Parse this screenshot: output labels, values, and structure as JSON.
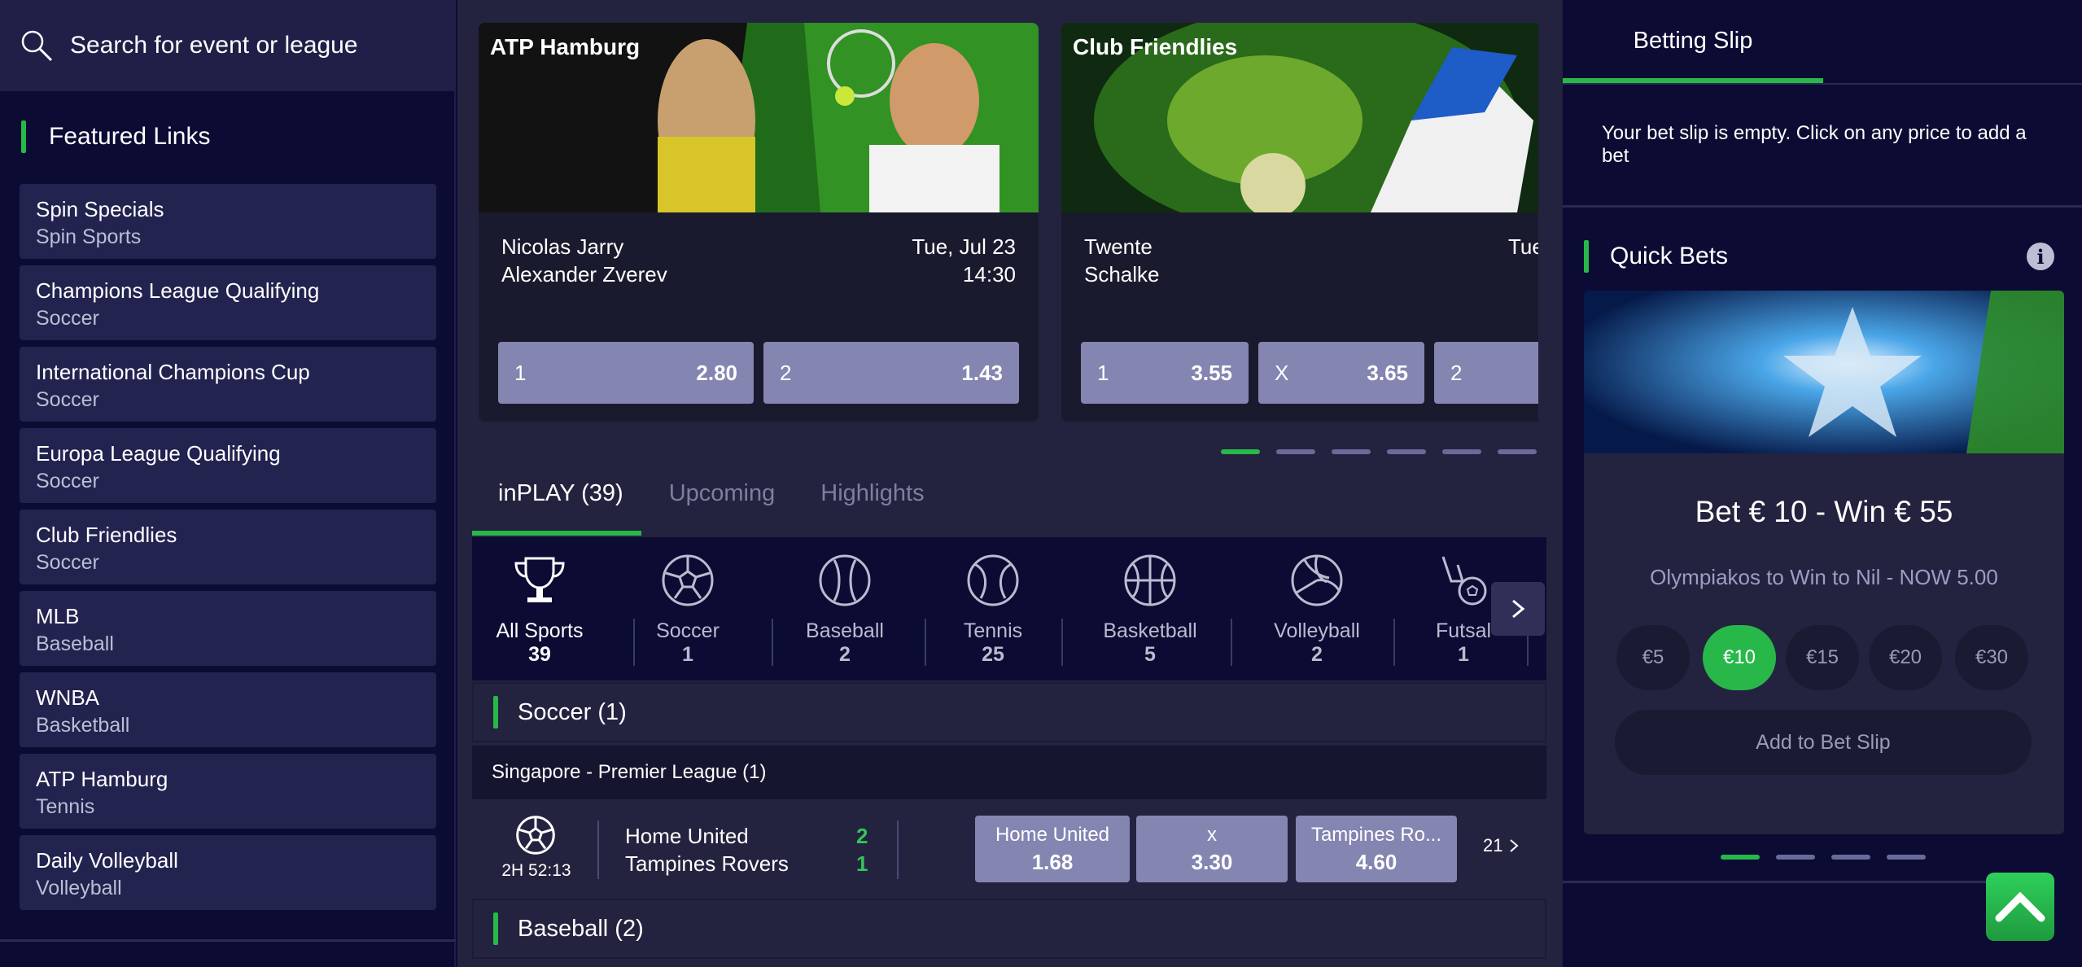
{
  "search": {
    "placeholder": "Search for event or league"
  },
  "featured": {
    "title": "Featured Links",
    "items": [
      {
        "name": "Spin Specials",
        "sport": "Spin Sports"
      },
      {
        "name": "Champions League Qualifying",
        "sport": "Soccer"
      },
      {
        "name": "International Champions Cup",
        "sport": "Soccer"
      },
      {
        "name": "Europa League Qualifying",
        "sport": "Soccer"
      },
      {
        "name": "Club Friendlies",
        "sport": "Soccer"
      },
      {
        "name": "MLB",
        "sport": "Baseball"
      },
      {
        "name": "WNBA",
        "sport": "Basketball"
      },
      {
        "name": "ATP Hamburg",
        "sport": "Tennis"
      },
      {
        "name": "Daily Volleyball",
        "sport": "Volleyball"
      }
    ]
  },
  "cards": [
    {
      "title": "ATP Hamburg",
      "team1": "Nicolas Jarry",
      "team2": "Alexander Zverev",
      "date": "Tue, Jul 23",
      "time": "14:30",
      "odds": [
        {
          "label": "1",
          "value": "2.80"
        },
        {
          "label": "2",
          "value": "1.43"
        }
      ]
    },
    {
      "title": "Club Friendlies",
      "team1": "Twente",
      "team2": "Schalke",
      "date": "Tue,",
      "odds": [
        {
          "label": "1",
          "value": "3.55"
        },
        {
          "label": "X",
          "value": "3.65"
        },
        {
          "label": "2",
          "value": ""
        }
      ]
    }
  ],
  "tabs": [
    {
      "label": "inPLAY (39)",
      "active": true
    },
    {
      "label": "Upcoming",
      "active": false
    },
    {
      "label": "Highlights",
      "active": false
    }
  ],
  "sports": [
    {
      "label": "All Sports",
      "count": "39",
      "icon": "trophy-icon"
    },
    {
      "label": "Soccer",
      "count": "1",
      "icon": "soccer-ball-icon"
    },
    {
      "label": "Baseball",
      "count": "2",
      "icon": "baseball-icon"
    },
    {
      "label": "Tennis",
      "count": "25",
      "icon": "tennis-ball-icon"
    },
    {
      "label": "Basketball",
      "count": "5",
      "icon": "basketball-icon"
    },
    {
      "label": "Volleyball",
      "count": "2",
      "icon": "volleyball-icon"
    },
    {
      "label": "Futsal",
      "count": "1",
      "icon": "futsal-icon"
    }
  ],
  "sections": {
    "soccer": "Soccer  (1)",
    "league": "Singapore - Premier League (1)",
    "baseball": "Baseball  (2)"
  },
  "match": {
    "time": "2H 52:13",
    "home": "Home United",
    "away": "Tampines Rovers",
    "home_score": "2",
    "away_score": "1",
    "odds": [
      {
        "label": "Home United",
        "value": "1.68"
      },
      {
        "label": "x",
        "value": "3.30"
      },
      {
        "label": "Tampines Ro...",
        "value": "4.60"
      }
    ],
    "more": "21"
  },
  "slip": {
    "tab": "Betting Slip",
    "empty": "Your bet slip is empty. Click on any price to add a bet"
  },
  "quick": {
    "title": "Quick Bets",
    "headline": "Bet € 10 - Win € 55",
    "sub": "Olympiakos to Win to Nil - NOW 5.00",
    "stakes": [
      "€5",
      "€10",
      "€15",
      "€20",
      "€30"
    ],
    "selected_stake": "€10",
    "add": "Add to Bet Slip"
  },
  "colors": {
    "accent": "#28b84a",
    "odds_button": "#8585b2",
    "background": "#0b0b33"
  }
}
